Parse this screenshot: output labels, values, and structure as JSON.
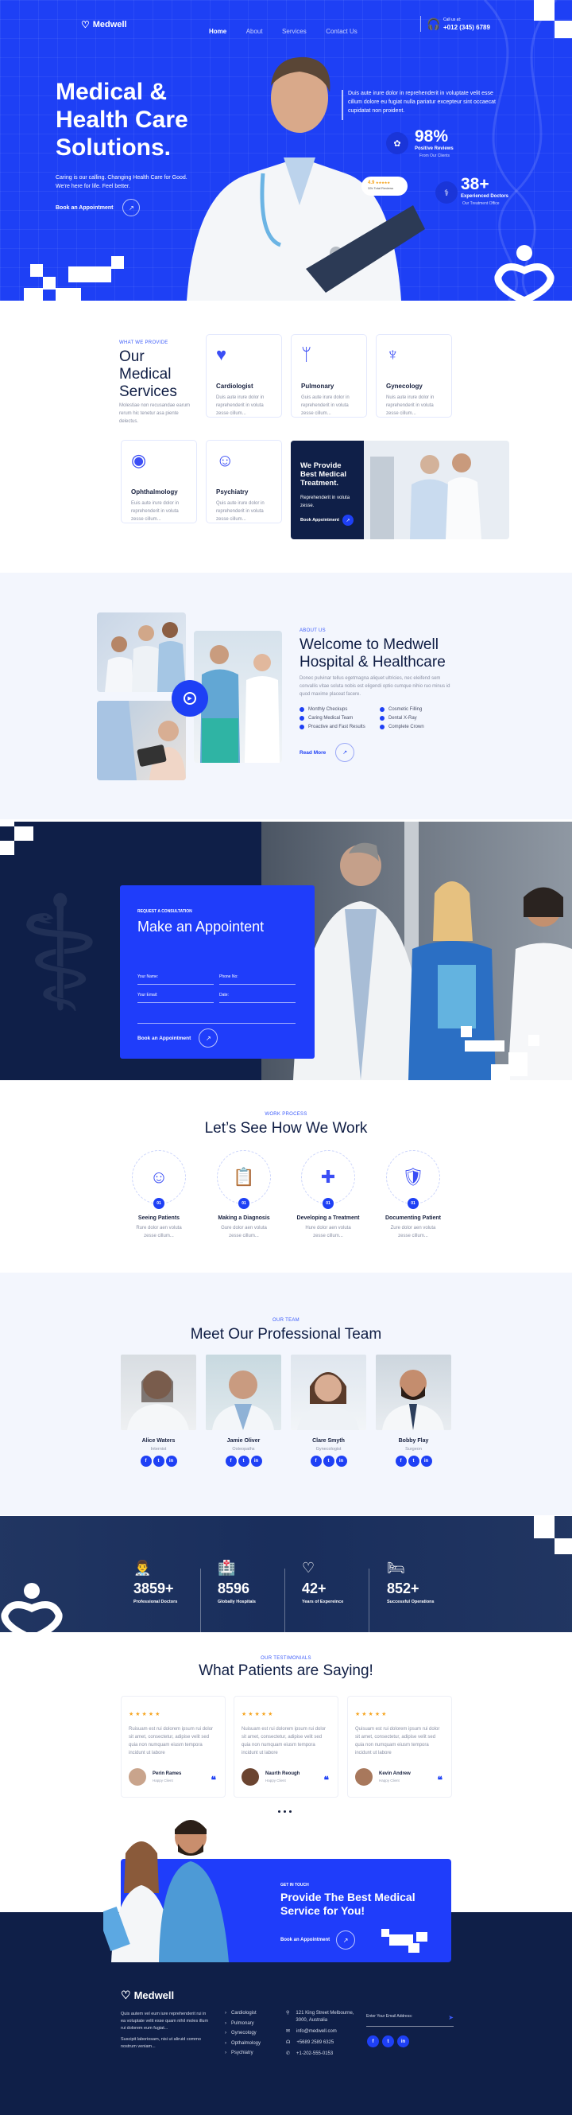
{
  "brand": {
    "name": "Medwell",
    "accent": "#1e40f5",
    "navy": "#0f1f48"
  },
  "header": {
    "nav": [
      {
        "label": "Home",
        "active": true
      },
      {
        "label": "About",
        "active": false
      },
      {
        "label": "Services",
        "active": false
      },
      {
        "label": "Contact Us",
        "active": false
      }
    ],
    "call_label": "Call us at:",
    "phone": "+012 (345) 6789"
  },
  "hero": {
    "title_line1": "Medical &",
    "title_line2": "Health Care",
    "title_line3": "Solutions.",
    "subtitle_line1": "Caring is our calling. Changing Health Care for Good.",
    "subtitle_line2": "We're here for life. Feel better.",
    "cta_label": "Book an Appointment",
    "description": "Duis aute irure dolor in reprehenderit in voluptate velit esse cillum dolore eu fugiat nulla pariatur excepteur sint occaecat cupidatat non proident.",
    "rating": {
      "value": "4.9",
      "stars": "★★★★★",
      "label": "32k Total Reviews"
    },
    "stats": [
      {
        "value": "98%",
        "label": "Positive Reviews",
        "sub": "From Our Clients"
      },
      {
        "value": "38+",
        "label": "Experienced Doctors",
        "sub": "Our Treatment Office"
      }
    ]
  },
  "services": {
    "eyebrow": "What We Provide",
    "title_line1": "Our",
    "title_line2": "Medical",
    "title_line3": "Services",
    "description": "Molestiae non recusandae earum rerum hic tenetur asa piente delectus.",
    "items": [
      {
        "icon": "heart-organ-icon",
        "title": "Cardiologist",
        "text": "Duis aute irure dolor in reprehenderit in voluta zesse cillum..."
      },
      {
        "icon": "lungs-icon",
        "title": "Pulmonary",
        "text": "Guis aute irure dolor in reprehenderit in voluta zesse cillum..."
      },
      {
        "icon": "uterus-icon",
        "title": "Gynecology",
        "text": "Nuis aute irure dolor in reprehenderit in voluta zesse cillum..."
      },
      {
        "icon": "eye-icon",
        "title": "Ophthalmology",
        "text": "Euis aute irure dolor in reprehenderit in voluta zesse cillum..."
      },
      {
        "icon": "brain-head-icon",
        "title": "Psychiatry",
        "text": "Quis aute irure dolor in reprehenderit in voluta zesse cillum..."
      }
    ],
    "promo": {
      "title": "We Provide Best Medical Treatment.",
      "text": "Reprehenderit in voluta zesse.",
      "cta_label": "Book Appointment"
    }
  },
  "about": {
    "eyebrow": "About Us",
    "title_line1": "Welcome to Medwell",
    "title_line2": "Hospital & Healthcare",
    "description": "Donec pulvinar tellus egetmagna aliquet ultricies, nec eleifend sem convallis vitae soluta nobis est eligendi optio cumque nihio ruo minus id quod maxime placeat facere.",
    "checklist_left": [
      "Monthly Checkups",
      "Caring Medical Team",
      "Proactive and Fast Results"
    ],
    "checklist_right": [
      "Cosmetic Filling",
      "Dental X-Ray",
      "Complete Crown"
    ],
    "cta_label": "Read More"
  },
  "appointment": {
    "eyebrow": "Request a Consultation",
    "title": "Make an Appointent",
    "fields": {
      "name": "Your Name:",
      "phone": "Phone No:",
      "email": "Your Email:",
      "date": "Date:"
    },
    "cta_label": "Book an Appointment"
  },
  "process": {
    "eyebrow": "Work Process",
    "title": "Let’s See How We Work",
    "steps": [
      {
        "num": "01",
        "icon": "doctor-face-icon",
        "title": "Seeing Patients",
        "text": "Rure dolor aen voluta zesse cillum..."
      },
      {
        "num": "01",
        "icon": "clipboard-icon",
        "title": "Making a Diagnosis",
        "text": "Gure dolor aen voluta zesse cillum..."
      },
      {
        "num": "01",
        "icon": "hand-medkit-icon",
        "title": "Developing a Treatment",
        "text": "Hure dolor aen voluta zesse cillum..."
      },
      {
        "num": "01",
        "icon": "document-shield-icon",
        "title": "Documenting Patient",
        "text": "Zure dolor aen voluta zesse cillum..."
      }
    ]
  },
  "team": {
    "eyebrow": "Our Team",
    "title": "Meet Our Professional Team",
    "members": [
      {
        "name": "Alice Waters",
        "role": "Internist"
      },
      {
        "name": "Jamie Oliver",
        "role": "Osteopaths"
      },
      {
        "name": "Clare Smyth",
        "role": "Gynecologist"
      },
      {
        "name": "Bobby Flay",
        "role": "Surgeon"
      }
    ],
    "social": [
      "f",
      "t",
      "in"
    ]
  },
  "counters": [
    {
      "icon": "doctor-icon",
      "value": "3859+",
      "label": "Professional Doctors"
    },
    {
      "icon": "hospital-icon",
      "value": "8596",
      "label": "Globally Hospitals"
    },
    {
      "icon": "heart-hands-icon",
      "value": "42+",
      "label": "Years of Expereince"
    },
    {
      "icon": "hospital-bed-icon",
      "value": "852+",
      "label": "Successful Operations"
    }
  ],
  "testimonials": {
    "eyebrow": "Our Testimonials",
    "title": "What Patients are Saying!",
    "items": [
      {
        "stars": "★★★★★",
        "text": "Ruisuam est rui dolorem ipsum rui dolor sit amet, consectetur, adipise velit sed quia non numquam eiusm tempora incidunt ut labore",
        "name": "Perin Rames",
        "role": "Happy Client"
      },
      {
        "stars": "★★★★★",
        "text": "Nuisuam est rui dolorem ipsum rui dolor sit amet, consectetur, adipise velit sed quia non numquam eiusm tempora incidunt ut labore",
        "name": "Naurth Reough",
        "role": "Happy Client"
      },
      {
        "stars": "★★★★★",
        "text": "Quisuam est rui dolorem ipsum rui dolor sit amet, consectetur, adipise velit sed quia non numquam eiusm tempora incidunt ut labore",
        "name": "Kevin Andrew",
        "role": "Happy Client"
      }
    ]
  },
  "cta": {
    "eyebrow": "Get In Touch",
    "title_line1": "Provide The Best Medical",
    "title_line2": "Service for You!",
    "cta_label": "Book an Appointment"
  },
  "footer": {
    "about_p1": "Quis autem vel eum iure reprehenderit rui in ea voluptate velit esse quam nihil moles illum rui dolorem eum fugiat...",
    "about_p2": "Suscipit laboriosam, nisi ut aliruid commo nostrum veniam...",
    "links": [
      "Cardiologist",
      "Pulmonary",
      "Gynecology",
      "Opthalmology",
      "Psychiatry"
    ],
    "address": "121 King Street Melbourne, 3000, Australia",
    "email": "info@medwell.com",
    "phone1": "+5689 2589 6325",
    "phone2": "+1-202-555-0153",
    "newsletter_placeholder": "Enter Your Email Address:"
  }
}
